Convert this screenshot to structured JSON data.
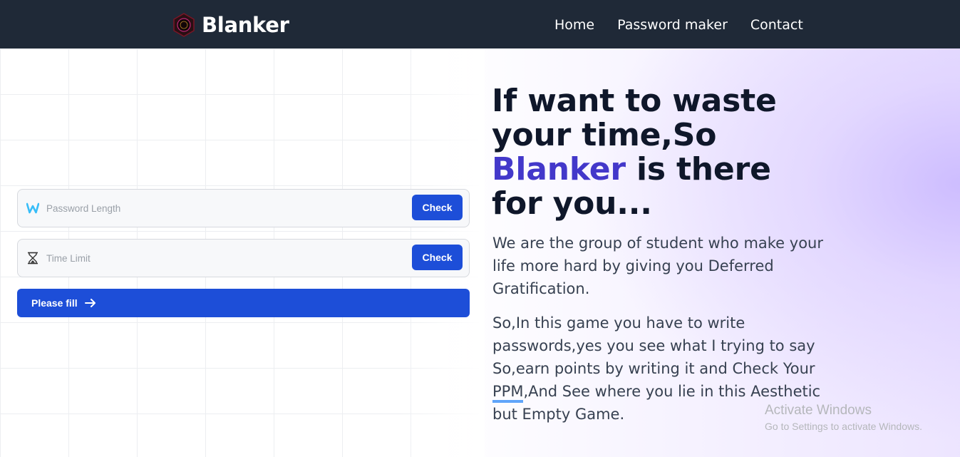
{
  "brand": {
    "name": "Blanker",
    "logo_icon": "hexagon-logo-icon"
  },
  "nav": {
    "items": [
      {
        "label": "Home"
      },
      {
        "label": "Password maker"
      },
      {
        "label": "Contact"
      }
    ]
  },
  "form": {
    "password_length": {
      "placeholder": "Password Length",
      "value": "",
      "icon": "w-letter-icon",
      "button_label": "Check"
    },
    "time_limit": {
      "placeholder": "Time Limit",
      "value": "",
      "icon": "hourglass-icon",
      "button_label": "Check"
    },
    "submit": {
      "label": "Please fill",
      "icon": "arrow-right-icon"
    }
  },
  "hero": {
    "title_part1": "If want to waste your time,So ",
    "title_accent": "Blanker",
    "title_part2": " is there for you...",
    "paragraph1": "We are the group of student who make your life more hard by giving you Deferred Gratification.",
    "paragraph2_before": "So,In this game you have to write passwords,yes you see what I trying to say So,earn points by writing it and Check Your ",
    "paragraph2_highlight": "PPM",
    "paragraph2_after": ",And See where you lie in this Aesthetic but Empty Game."
  },
  "watermark": {
    "line1": "Activate Windows",
    "line2": "Go to Settings to activate Windows."
  },
  "colors": {
    "navbar": "#1f2937",
    "primary_button": "#1d4ed8",
    "accent_text": "#4338ca",
    "highlight_underline": "#60a5fa"
  }
}
